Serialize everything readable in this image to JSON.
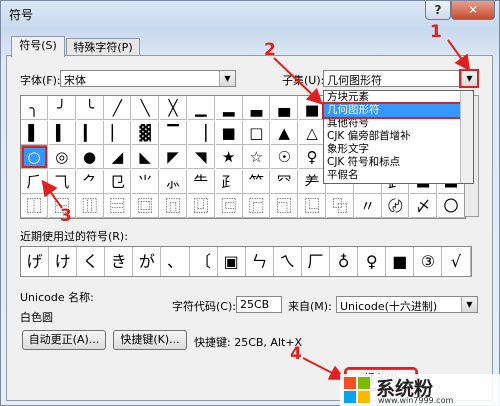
{
  "window": {
    "title": "符号",
    "help_label": "?",
    "close_label": "✕"
  },
  "tabs": [
    {
      "label": "符号(S)"
    },
    {
      "label": "特殊字符(P)"
    }
  ],
  "font": {
    "label": "字体(F):",
    "value": "宋体"
  },
  "subset": {
    "label": "子集(U):",
    "value": "几何图形符",
    "list": [
      "方块元素",
      "几何图形符",
      "其他符号",
      "CJK 偏旁部首增补",
      "象形文字",
      "CJK 符号和标点",
      "平假名"
    ],
    "selected_index": 1
  },
  "symbol_grid": {
    "rows": [
      [
        "╮",
        "╯",
        "╰",
        "╱",
        "╲",
        "╳",
        "▁",
        "▂",
        "▃",
        "▄",
        "▅",
        "▆",
        "▇",
        "█",
        "▉",
        "▊"
      ],
      [
        "▌",
        "▍",
        "▎",
        "▏",
        "▓",
        "▔",
        "▕",
        "■",
        "□",
        "▲",
        "△",
        "▼",
        "▽",
        "◆",
        "◇",
        "◈"
      ],
      [
        "○",
        "◎",
        "●",
        "◢",
        "◣",
        "◤",
        "◥",
        "★",
        "☆",
        "☉",
        "♀",
        "♂",
        "♩",
        "♪",
        "♫",
        "♬"
      ],
      [
        "⺁",
        "⺄",
        "⺈",
        "⺋",
        "⺌",
        "⺗",
        "⺧",
        "⺪",
        "⺮",
        "⺳",
        "⺶",
        "⺷",
        "⺻",
        "⻊",
        "〓",
        "〓"
      ],
      [
        "⿰",
        "⿱",
        "⿲",
        "⿳",
        "⿴",
        "⿵",
        "⿶",
        "⿷",
        "⿸",
        "⿹",
        "⿺",
        "⿻",
        "〃",
        "〄",
        "〆",
        "〇"
      ]
    ],
    "selected": {
      "row": 2,
      "col": 0
    }
  },
  "recent": {
    "label": "近期使用过的符号(R):",
    "symbols": [
      "げ",
      "け",
      "く",
      "き",
      "が",
      "、",
      "〔",
      "▣",
      "ㄣ",
      "ㄟ",
      "厂",
      "♁",
      "♀",
      "■",
      "③",
      "√"
    ]
  },
  "unicode": {
    "name_label": "Unicode 名称:",
    "name_value": "白色圆"
  },
  "char_code": {
    "label": "字符代码(C):",
    "value": "25CB"
  },
  "from": {
    "label": "来自(M):",
    "value": "Unicode(十六进制)"
  },
  "buttons": {
    "autocorrect": "自动更正(A)...",
    "shortcut": "快捷键(K)...",
    "insert": "插入(I)"
  },
  "shortcut_info": "快捷键: 25CB, Alt+X",
  "annotations": [
    "1",
    "2",
    "3",
    "4"
  ],
  "watermark": "系统粉",
  "watermark_url": "www.win7999.com",
  "colors": {
    "annotation": "#e02020",
    "selection": "#3399ff"
  }
}
